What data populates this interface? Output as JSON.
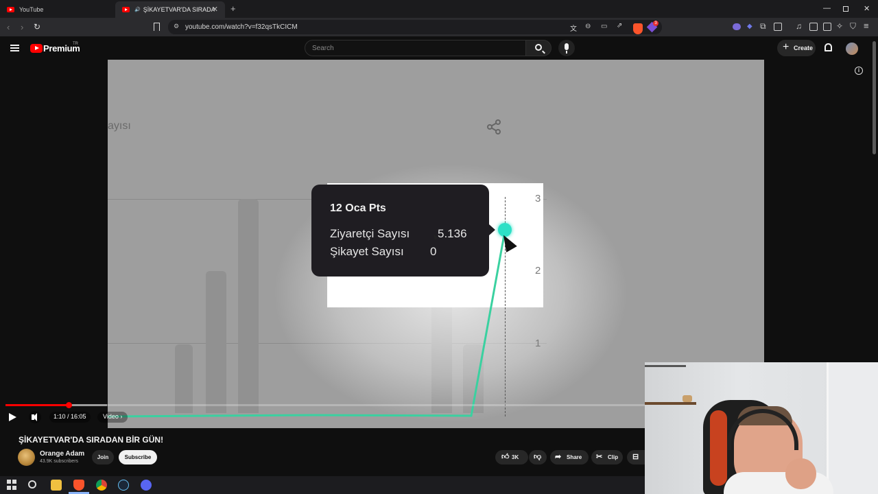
{
  "browser": {
    "tabs": [
      {
        "title": "YouTube",
        "active": false
      },
      {
        "title": "ŞİKAYETVAR'DA SIRADAN BİR",
        "active": true
      }
    ],
    "url": "youtube.com/watch?v=f32qsTkCICM",
    "extension_badge": "3"
  },
  "header": {
    "logo_text": "Premium",
    "logo_region": "TR",
    "search_placeholder": "Search",
    "create_label": "Create"
  },
  "video_frame": {
    "side_label": "ayısı",
    "tooltip": {
      "date": "12 Oca Pts",
      "rows": [
        {
          "label": "Ziyaretçi Sayısı",
          "value": "5.136"
        },
        {
          "label": "Şikayet Sayısı",
          "value": "0"
        }
      ]
    },
    "axis_ticks": [
      "3",
      "2",
      "1"
    ]
  },
  "player": {
    "progress": 0.073,
    "buffered": 0.117,
    "time": "1:10 / 16:05",
    "chapter": "Video"
  },
  "video_info": {
    "title": "ŞİKAYETVAR'DA SIRADAN BİR GÜN!",
    "channel": "Orange Adam",
    "subscribers": "43.9K subscribers",
    "join_label": "Join",
    "subscribe_label": "Subscribe",
    "likes": "3K",
    "share_label": "Share",
    "clip_label": "Clip"
  },
  "colors": {
    "accent_red": "#ff0000",
    "line_green": "#3ad1a0",
    "point_cyan": "#2de0c6"
  },
  "taskbar": {
    "icons": [
      "windows-icon",
      "search-icon",
      "file-explorer-icon",
      "brave-icon",
      "chrome-icon",
      "steam-icon",
      "discord-icon"
    ]
  }
}
